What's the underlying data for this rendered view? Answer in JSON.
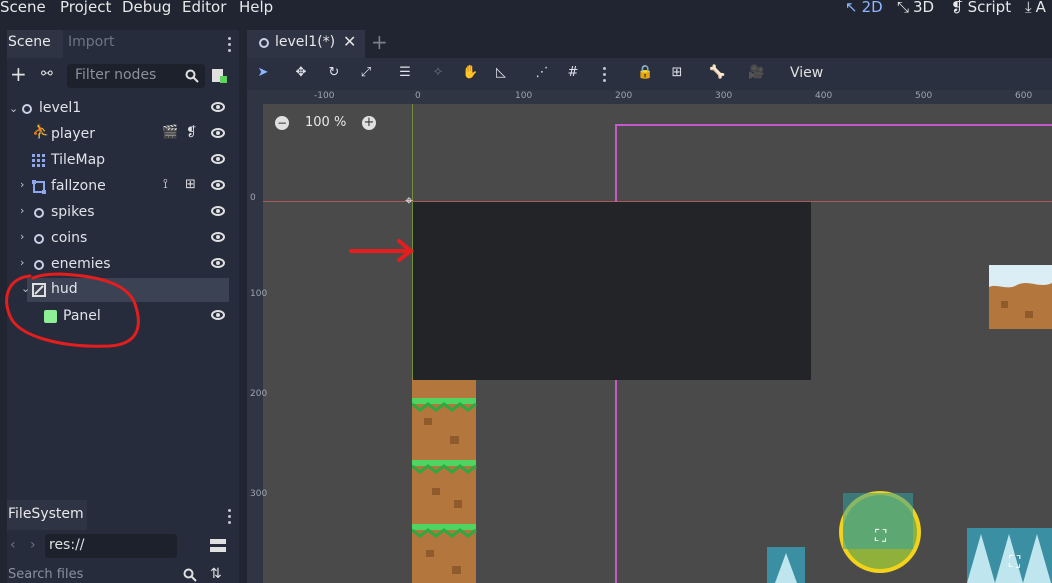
{
  "menu": [
    "Scene",
    "Project",
    "Debug",
    "Editor",
    "Help"
  ],
  "modes": [
    "2D",
    "3D",
    "Script",
    "A"
  ],
  "scene_dock": {
    "tabs": [
      "Scene",
      "Import"
    ],
    "filter_placeholder": "Filter nodes",
    "nodes": [
      {
        "label": "level1"
      },
      {
        "label": "player"
      },
      {
        "label": "TileMap"
      },
      {
        "label": "fallzone"
      },
      {
        "label": "spikes"
      },
      {
        "label": "coins"
      },
      {
        "label": "enemies"
      },
      {
        "label": "hud"
      },
      {
        "label": "Panel"
      }
    ]
  },
  "filesystem": {
    "tab": "FileSystem",
    "path": "res://",
    "search_placeholder": "Search files"
  },
  "editor": {
    "tab_title": "level1(*)",
    "zoom": "100 %",
    "view_label": "View",
    "ruler_top": [
      "-100",
      "0",
      "100",
      "200",
      "300",
      "400",
      "500",
      "600"
    ],
    "ruler_left": [
      "0",
      "100",
      "200",
      "300"
    ]
  },
  "colors": {
    "annotation": "#e41e1e",
    "panel_dark": "#232428",
    "camera_border": "#c35ac8"
  }
}
